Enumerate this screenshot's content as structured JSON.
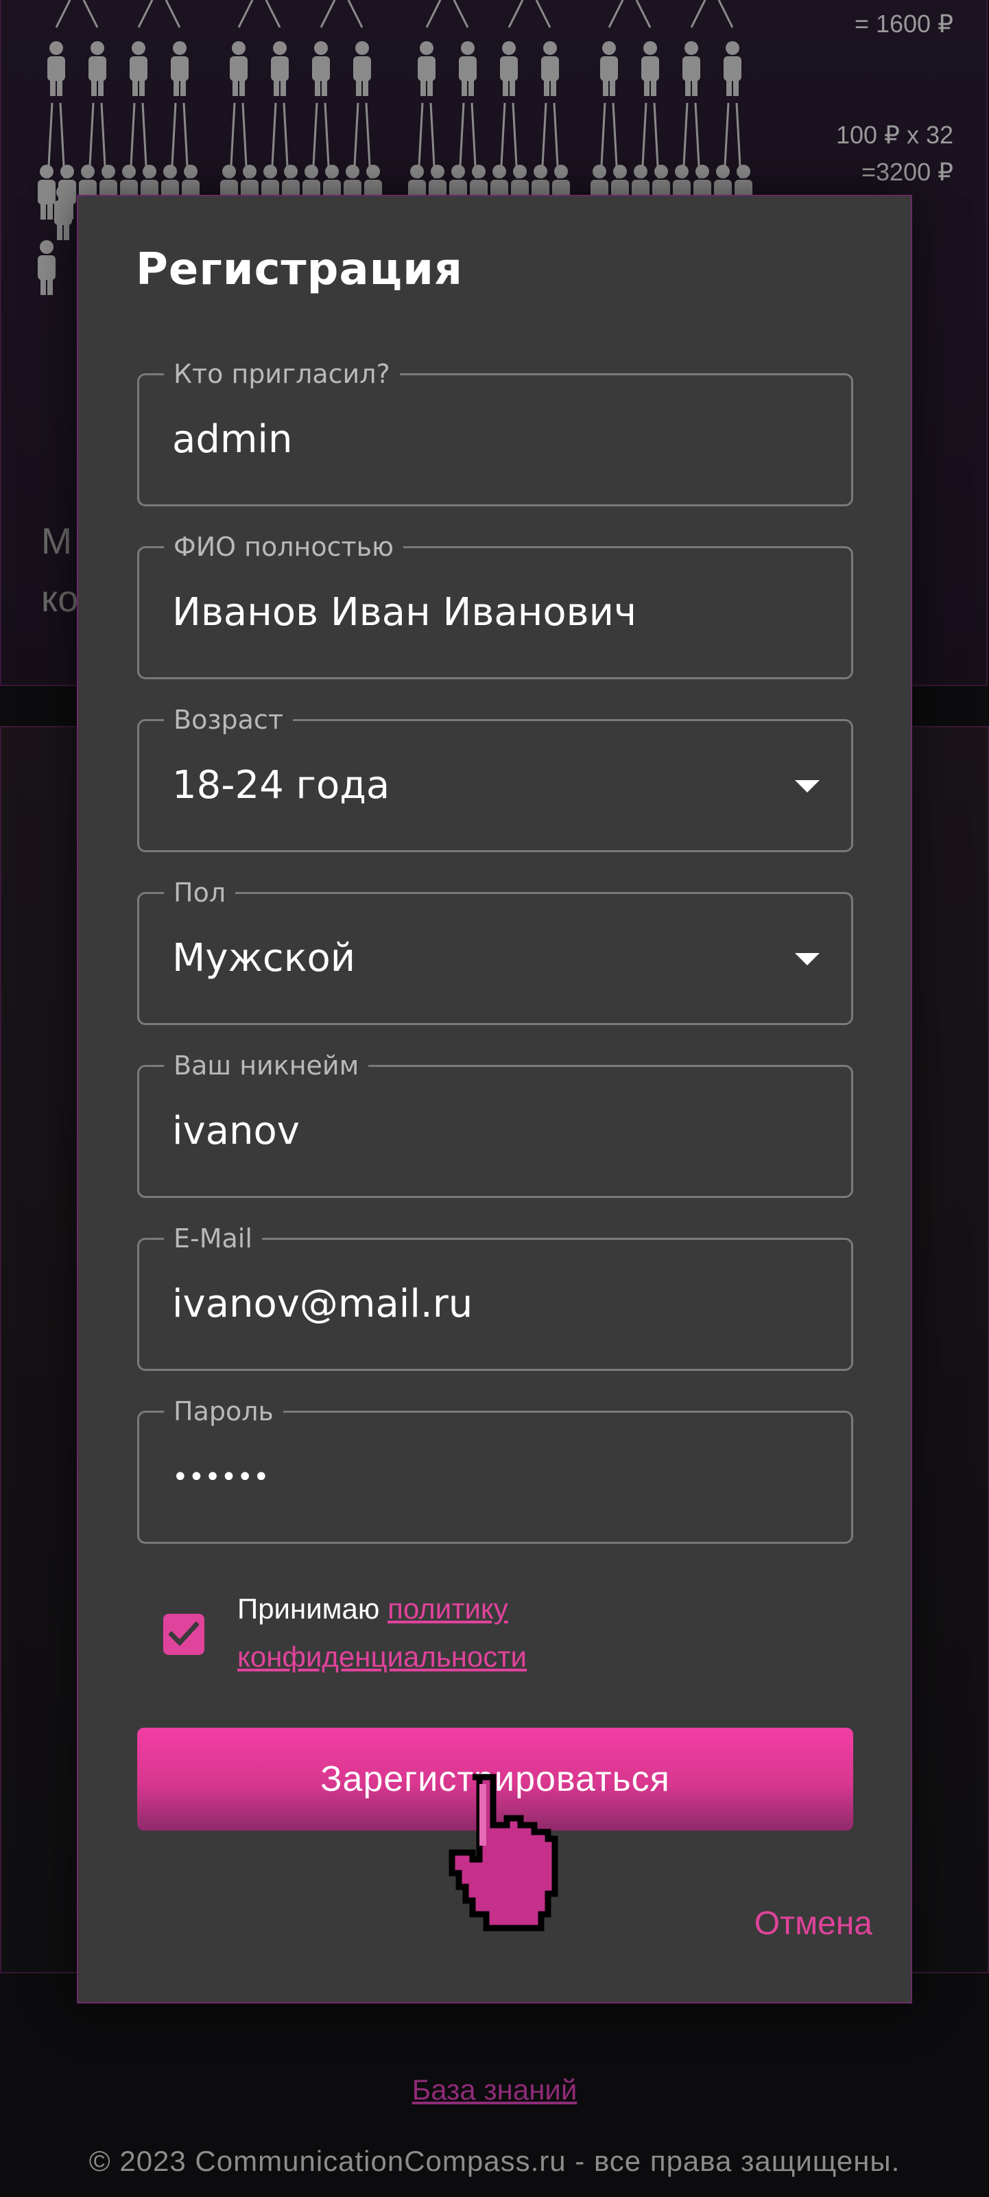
{
  "background": {
    "money_line1": "= 1600 ₽",
    "money_line2": "100 ₽ x 32",
    "money_line3": "=3200 ₽",
    "partial_text_line1": "М",
    "partial_text_line2": "ко"
  },
  "modal": {
    "title": "Регистрация",
    "fields": [
      {
        "label": "Кто пригласил?",
        "value": "admin"
      },
      {
        "label": "ФИО полностью",
        "value": "Иванов Иван Иванович"
      },
      {
        "label": "Возраст",
        "value": "18-24 года"
      },
      {
        "label": "Пол",
        "value": "Мужской"
      },
      {
        "label": "Ваш никнейм",
        "value": "ivanov"
      },
      {
        "label": "E-Mail",
        "value": "ivanov@mail.ru"
      },
      {
        "label": "Пароль",
        "value": "••••••"
      }
    ],
    "consent_prefix": "Принимаю ",
    "consent_link": "политику конфиденциальности",
    "consent_checked": true,
    "submit_label": "Зарегистрироваться",
    "cancel_label": "Отмена"
  },
  "footer": {
    "knowledge_link": "База знаний",
    "copyright": "© 2023 CommunicationCompass.ru - все права защищены."
  },
  "colors": {
    "accent": "#e0439b",
    "modal_bg": "#3a3a3a",
    "page_bg": "#0c0b0d"
  }
}
